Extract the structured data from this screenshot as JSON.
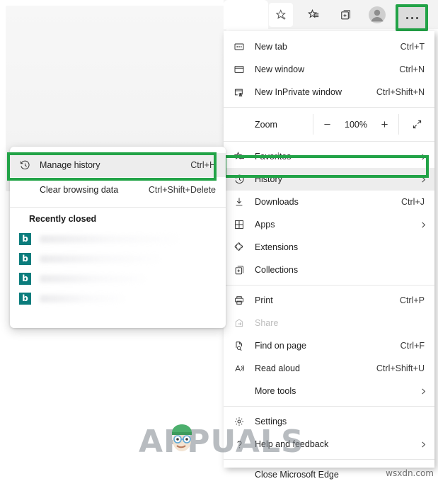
{
  "toolbar": {
    "buttons": [
      {
        "name": "add-favorite",
        "icon": "star-plus-icon",
        "label": ""
      },
      {
        "name": "favorites",
        "icon": "favorites-list-icon",
        "label": ""
      },
      {
        "name": "collections",
        "icon": "collections-icon",
        "label": ""
      },
      {
        "name": "profile",
        "icon": "avatar-icon",
        "label": ""
      },
      {
        "name": "settings-and-more",
        "icon": "ellipsis-icon",
        "label": ""
      }
    ]
  },
  "menu": {
    "items": [
      {
        "label": "New tab",
        "accel": "Ctrl+T",
        "icon": "new-tab-icon",
        "chevron": false,
        "disabled": false
      },
      {
        "label": "New window",
        "accel": "Ctrl+N",
        "icon": "new-window-icon",
        "chevron": false,
        "disabled": false
      },
      {
        "label": "New InPrivate window",
        "accel": "Ctrl+Shift+N",
        "icon": "inprivate-icon",
        "chevron": false,
        "disabled": false
      },
      {
        "label": "Favorites",
        "accel": "",
        "icon": "favorites-icon",
        "chevron": true,
        "disabled": false
      },
      {
        "label": "History",
        "accel": "",
        "icon": "history-icon",
        "chevron": true,
        "disabled": false
      },
      {
        "label": "Downloads",
        "accel": "Ctrl+J",
        "icon": "download-icon",
        "chevron": false,
        "disabled": false
      },
      {
        "label": "Apps",
        "accel": "",
        "icon": "apps-icon",
        "chevron": true,
        "disabled": false
      },
      {
        "label": "Extensions",
        "accel": "",
        "icon": "extensions-icon",
        "chevron": false,
        "disabled": false
      },
      {
        "label": "Collections",
        "accel": "",
        "icon": "collections-icon",
        "chevron": false,
        "disabled": false
      },
      {
        "label": "Print",
        "accel": "Ctrl+P",
        "icon": "print-icon",
        "chevron": false,
        "disabled": false
      },
      {
        "label": "Share",
        "accel": "",
        "icon": "share-icon",
        "chevron": false,
        "disabled": true
      },
      {
        "label": "Find on page",
        "accel": "Ctrl+F",
        "icon": "find-icon",
        "chevron": false,
        "disabled": false
      },
      {
        "label": "Read aloud",
        "accel": "Ctrl+Shift+U",
        "icon": "read-aloud-icon",
        "chevron": false,
        "disabled": false
      },
      {
        "label": "More tools",
        "accel": "",
        "icon": "",
        "chevron": true,
        "disabled": false
      },
      {
        "label": "Settings",
        "accel": "",
        "icon": "settings-icon",
        "chevron": false,
        "disabled": false
      },
      {
        "label": "Help and feedback",
        "accel": "",
        "icon": "help-icon",
        "chevron": true,
        "disabled": false
      },
      {
        "label": "Close Microsoft Edge",
        "accel": "",
        "icon": "",
        "chevron": false,
        "disabled": false
      }
    ],
    "zoom": {
      "label": "Zoom",
      "value": "100%",
      "minus_label": "—",
      "plus_label": "+"
    },
    "highlight_color": "#22a347",
    "highlighted_item": "History"
  },
  "history_panel": {
    "manage_history": {
      "label": "Manage history",
      "accel": "Ctrl+H",
      "icon": "history-icon"
    },
    "clear_browsing": {
      "label": "Clear browsing data",
      "accel": "Ctrl+Shift+Delete"
    },
    "section_title": "Recently closed",
    "recent_items": [
      {
        "icon": "bing-favicon",
        "glyph": "b",
        "label": ""
      },
      {
        "icon": "bing-favicon",
        "glyph": "b",
        "label": ""
      },
      {
        "icon": "bing-favicon",
        "glyph": "b",
        "label": ""
      },
      {
        "icon": "bing-favicon",
        "glyph": "b",
        "label": ""
      }
    ],
    "favicon_color": "#0b7c7c",
    "highlighted_item": "Manage history"
  },
  "watermarks": {
    "brand": "APPUALS",
    "site": "wsxdn.com"
  }
}
